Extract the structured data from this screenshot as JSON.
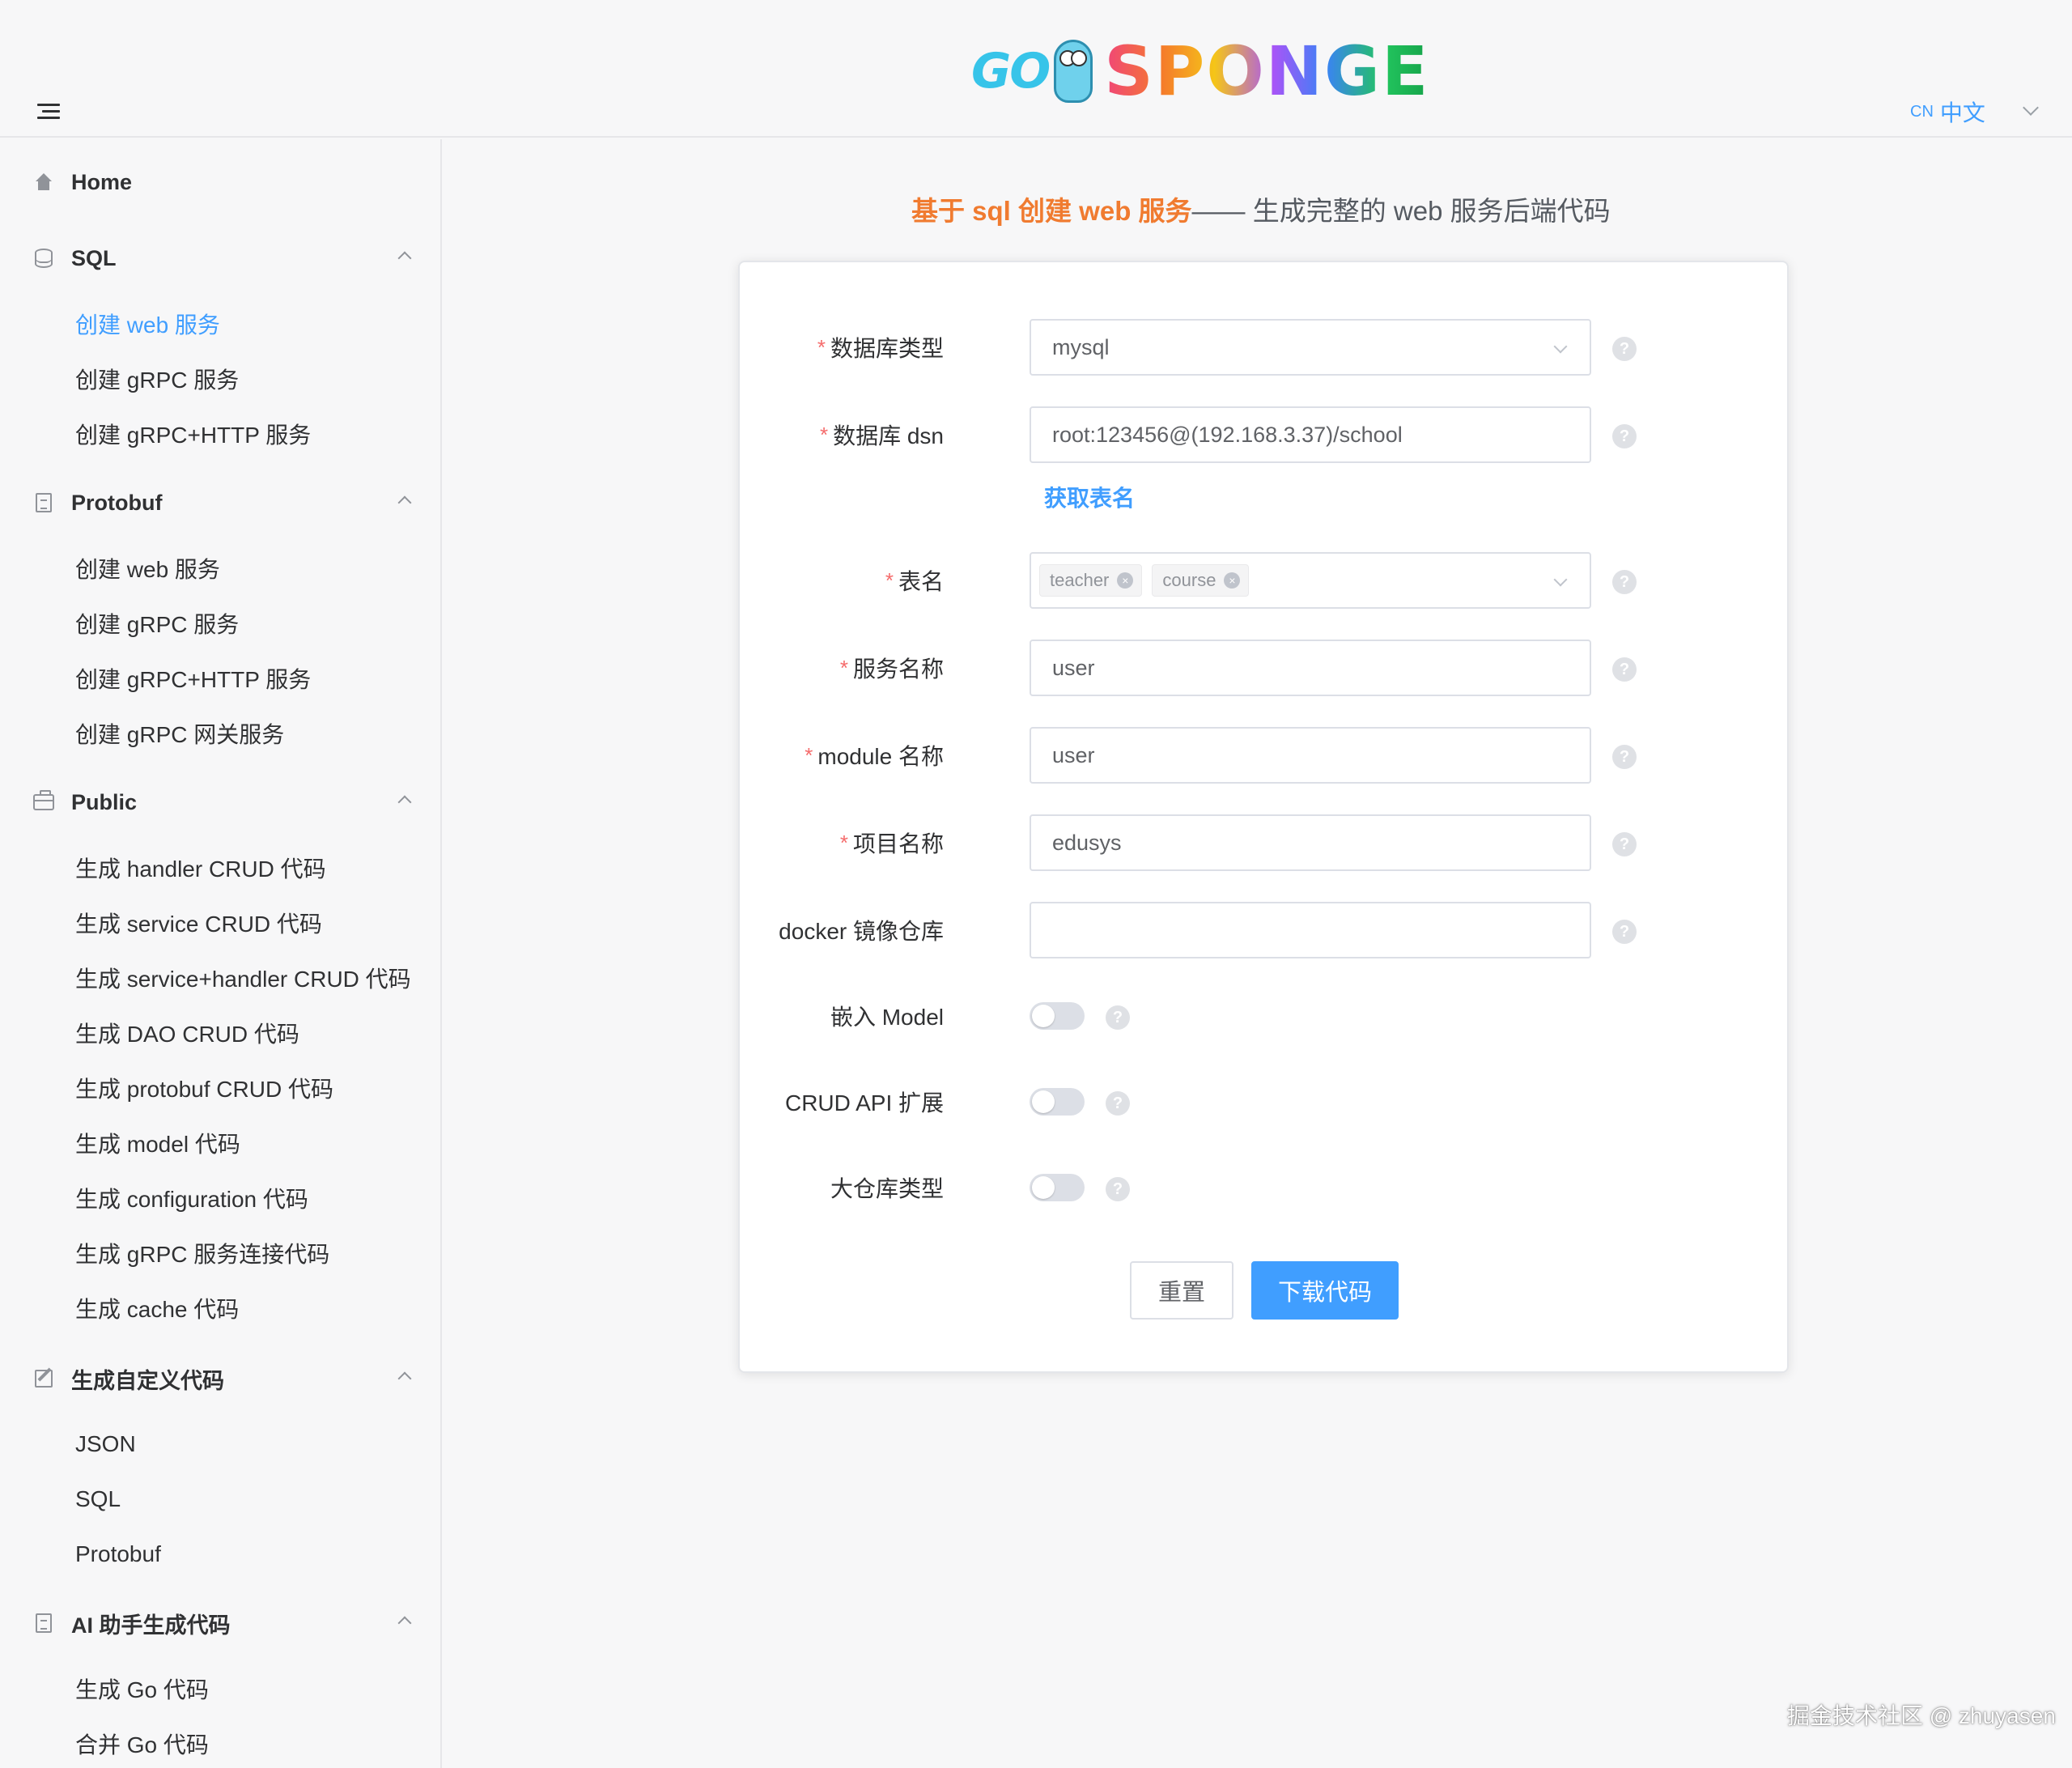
{
  "header": {
    "logo_go": "GO",
    "logo_sponge": "SPONGE",
    "lang_code": "CN",
    "lang_label": "中文"
  },
  "sidebar": {
    "home": "Home",
    "groups": [
      {
        "label": "SQL",
        "items": [
          "创建 web 服务",
          "创建 gRPC 服务",
          "创建 gRPC+HTTP 服务"
        ]
      },
      {
        "label": "Protobuf",
        "items": [
          "创建 web 服务",
          "创建 gRPC 服务",
          "创建 gRPC+HTTP 服务",
          "创建 gRPC 网关服务"
        ]
      },
      {
        "label": "Public",
        "items": [
          "生成 handler CRUD 代码",
          "生成 service CRUD 代码",
          "生成 service+handler CRUD 代码",
          "生成 DAO CRUD 代码",
          "生成 protobuf CRUD 代码",
          "生成 model 代码",
          "生成 configuration 代码",
          "生成 gRPC 服务连接代码",
          "生成 cache 代码"
        ]
      },
      {
        "label": "生成自定义代码",
        "items": [
          "JSON",
          "SQL",
          "Protobuf"
        ]
      },
      {
        "label": "AI 助手生成代码",
        "items": [
          "生成 Go 代码",
          "合并 Go 代码"
        ]
      }
    ]
  },
  "main": {
    "title_highlight": "基于 sql 创建 web 服务",
    "title_rest": " —— 生成完整的 web 服务后端代码",
    "form": {
      "required_mark": "*",
      "help_glyph": "?",
      "tag_close_glyph": "×",
      "db_type": {
        "label": "数据库类型",
        "value": "mysql"
      },
      "db_dsn": {
        "label": "数据库 dsn",
        "value": "root:123456@(192.168.3.37)/school"
      },
      "get_tables": "获取表名",
      "tables": {
        "label": "表名",
        "values": [
          "teacher",
          "course"
        ]
      },
      "service_name": {
        "label": "服务名称",
        "value": "user"
      },
      "module_name": {
        "label": "module 名称",
        "value": "user"
      },
      "project_name": {
        "label": "项目名称",
        "value": "edusys"
      },
      "docker_repo": {
        "label": "docker 镜像仓库",
        "value": ""
      },
      "embed_model": {
        "label": "嵌入 Model",
        "on": false
      },
      "crud_api_ext": {
        "label": "CRUD API 扩展",
        "on": false
      },
      "mono_repo": {
        "label": "大仓库类型",
        "on": false
      },
      "reset": "重置",
      "download": "下载代码"
    }
  },
  "watermark": "掘金技术社区 @ zhuyasen",
  "colors": {
    "accent": "#409eff",
    "title_highlight": "#f07b30",
    "required": "#f56c6c"
  }
}
